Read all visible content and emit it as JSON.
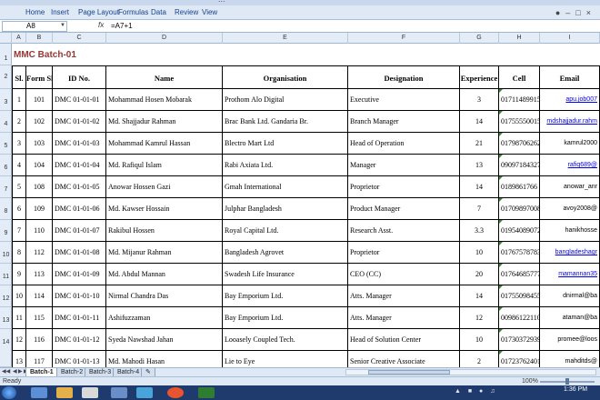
{
  "window": {
    "title": "..."
  },
  "ribbon": {
    "tabs": [
      "Home",
      "Insert",
      "Page Layout",
      "Formulas",
      "Data",
      "Review",
      "View"
    ]
  },
  "formula_bar": {
    "name_box": "A8",
    "formula": "=A7+1"
  },
  "columns": [
    "A",
    "B",
    "C",
    "D",
    "E",
    "F",
    "G",
    "H",
    "I"
  ],
  "rows": [
    "1",
    "2",
    "3",
    "4",
    "5",
    "6",
    "7",
    "8",
    "9",
    "10",
    "11",
    "12",
    "13",
    "14"
  ],
  "sheet": {
    "title": "MMC Batch-01",
    "headers": [
      "Sl.",
      "Form Sl.",
      "ID No.",
      "Name",
      "Organisation",
      "Designation",
      "Experience",
      "Cell",
      "Email"
    ],
    "records": [
      [
        "1",
        "101",
        "DMC 01-01-01",
        "Mohammad Hosen Mobarak",
        "Prothom Alo Digital",
        "Executive",
        "3",
        "01711489915",
        "apu.job007"
      ],
      [
        "2",
        "102",
        "DMC 01-01-02",
        "Md. Shajjadur Rahman",
        "Brac Bank Ltd. Gandaria Br.",
        "Branch Manager",
        "14",
        "01755550015",
        "mdshajjadur.rahm"
      ],
      [
        "3",
        "103",
        "DMC 01-01-03",
        "Mohammad Kamrul Hassan",
        "Blectro Mart Ltd",
        "Head of Operation",
        "21",
        "01798706262",
        "kamrul2000"
      ],
      [
        "4",
        "104",
        "DMC 01-01-04",
        "Md. Rafiqul Islam",
        "Rabi Axiata Ltd.",
        "Manager",
        "13",
        "09097184327",
        "rafiq689@"
      ],
      [
        "5",
        "108",
        "DMC 01-01-05",
        "Anowar Hossen Gazi",
        "Gmah International",
        "Proprietor",
        "14",
        "0189861766",
        "anowar_anr"
      ],
      [
        "6",
        "109",
        "DMC 01-01-06",
        "Md. Kawser Hossain",
        "Julphar Bangladesh",
        "Product Manager",
        "7",
        "01709897008",
        "avoy2008@"
      ],
      [
        "7",
        "110",
        "DMC 01-01-07",
        "Rakibul Hossen",
        "Royal Capital Ltd.",
        "Research Asst.",
        "3.3",
        "01954089072",
        "hanikhosse"
      ],
      [
        "8",
        "112",
        "DMC 01-01-08",
        "Md. Mijanur Rahman",
        "Bangladesh Agrovet",
        "Proprietor",
        "10",
        "01767578783",
        "bangladeshagr"
      ],
      [
        "9",
        "113",
        "DMC 01-01-09",
        "Md. Abdul Mannan",
        "Swadesh Life Insurance",
        "CEO (CC)",
        "20",
        "01764685777",
        "mamannan35"
      ],
      [
        "10",
        "114",
        "DMC 01-01-10",
        "Nirmal Chandra Das",
        "Bay Emporium Ltd.",
        "Atts. Manager",
        "14",
        "01755098455",
        "dnirmal@ba"
      ],
      [
        "11",
        "115",
        "DMC 01-01-11",
        "Ashifuzzaman",
        "Bay Emporium Ltd.",
        "Atts. Manager",
        "12",
        "00986122110",
        "ataman@ba"
      ],
      [
        "12",
        "116",
        "DMC 01-01-12",
        "Syeda Nawshad Jahan",
        "Looasely Coupled Tech.",
        "Head of Solution Center",
        "10",
        "01730372939",
        "promee@loos"
      ],
      [
        "13",
        "117",
        "DMC 01-01-13",
        "Md. Mahodi Hasan",
        "Lie to Eye",
        "Senior Creative Associate",
        "2",
        "01723762401",
        "mahditds@"
      ]
    ]
  },
  "sheet_tabs": [
    "Batch-1",
    "Batch-2",
    "Batch-3",
    "Batch-4"
  ],
  "status": {
    "text": "Ready",
    "zoom": "100%"
  },
  "clock": {
    "time": "1:36 PM"
  }
}
